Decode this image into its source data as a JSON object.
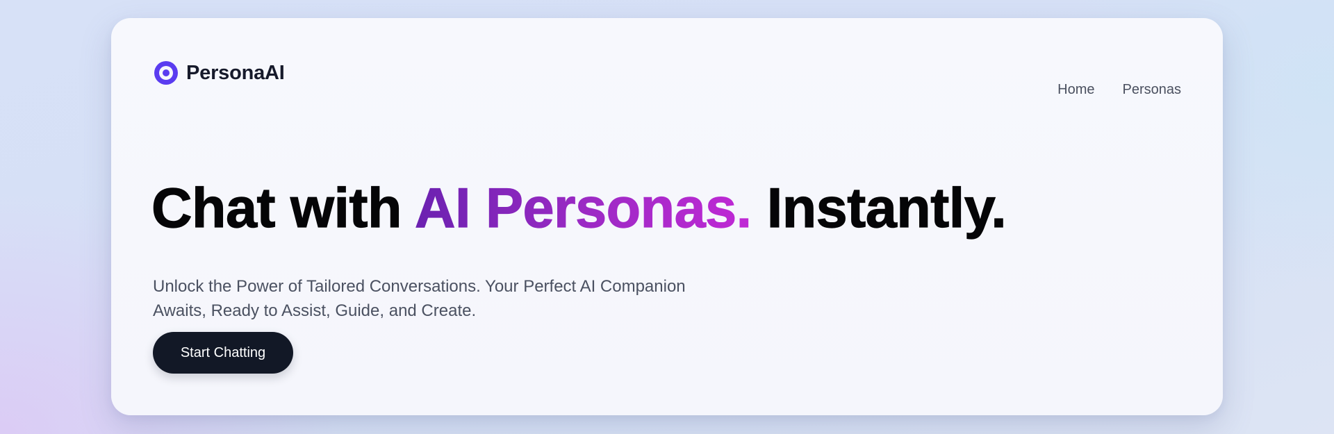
{
  "brand": {
    "name": "PersonaAI",
    "icon": "target-icon",
    "accent_color": "#5a3cf0"
  },
  "nav": {
    "items": [
      {
        "label": "Home"
      },
      {
        "label": "Personas"
      }
    ]
  },
  "hero": {
    "headline_start": "Chat with ",
    "headline_accent": "AI Personas.",
    "headline_end": " Instantly.",
    "subtitle": "Unlock the Power of Tailored Conversations. Your Perfect AI Companion Awaits, Ready to Assist, Guide, and Create.",
    "cta_label": "Start Chatting",
    "accent_gradient": [
      "#6b21b0",
      "#9b2ac4",
      "#c029d5"
    ],
    "cta_color": "#121826"
  }
}
